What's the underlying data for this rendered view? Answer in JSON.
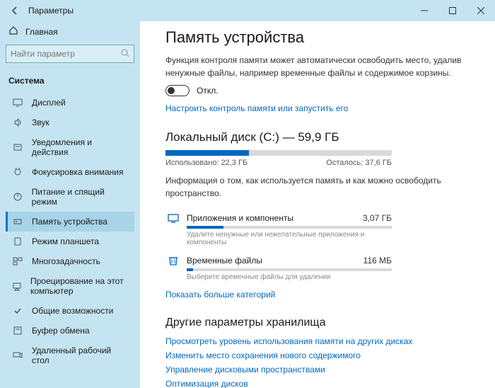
{
  "window": {
    "title": "Параметры"
  },
  "sidebar": {
    "home": "Главная",
    "search_placeholder": "Найти параметр",
    "section": "Система",
    "items": [
      {
        "label": "Дисплей"
      },
      {
        "label": "Звук"
      },
      {
        "label": "Уведомления и действия"
      },
      {
        "label": "Фокусировка внимания"
      },
      {
        "label": "Питание и спящий режим"
      },
      {
        "label": "Память устройства"
      },
      {
        "label": "Режим планшета"
      },
      {
        "label": "Многозадачность"
      },
      {
        "label": "Проецирование на этот компьютер"
      },
      {
        "label": "Общие возможности"
      },
      {
        "label": "Буфер обмена"
      },
      {
        "label": "Удаленный рабочий стол"
      }
    ]
  },
  "page": {
    "title": "Память устройства",
    "desc": "Функция контроля памяти может автоматически освободить место, удалив ненужные файлы, например временные файлы и содержимое корзины.",
    "toggle_state": "Откл.",
    "config_link": "Настроить контроль памяти или запустить его",
    "disk": {
      "title": "Локальный диск (C:) — 59,9 ГБ",
      "used_pct": 37,
      "used": "Использовано: 22,3 ГБ",
      "free": "Осталось: 37,6 ГБ",
      "info": "Информация о том, как используется память и как можно освободить пространство."
    },
    "categories": [
      {
        "name": "Приложения и компоненты",
        "size": "3,07 ГБ",
        "pct": 18,
        "hint": "Удалите ненужные или нежелательные приложения и компоненты"
      },
      {
        "name": "Временные файлы",
        "size": "116 МБ",
        "pct": 3,
        "hint": "Выберите временные файлы для удаления"
      }
    ],
    "more_link": "Показать больше категорий",
    "other": {
      "heading": "Другие параметры хранилища",
      "links": [
        "Просмотреть уровень использования памяти на других дисках",
        "Изменить место сохранения нового содержимого",
        "Управление дисковыми пространствами",
        "Оптимизация дисков"
      ]
    }
  }
}
